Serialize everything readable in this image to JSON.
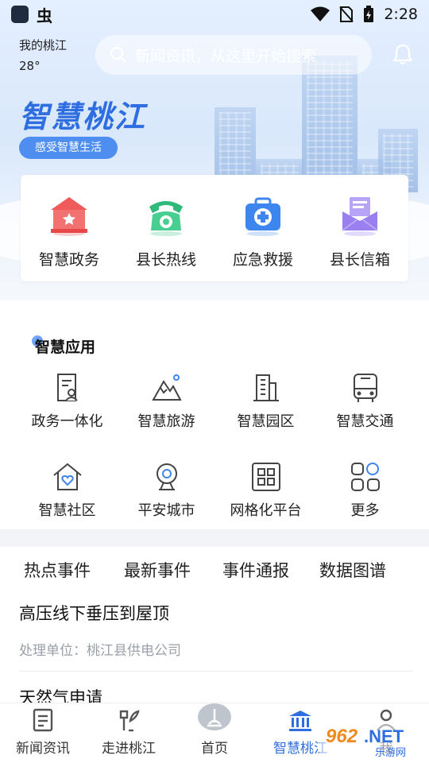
{
  "status_bar": {
    "time": "2:28",
    "app_glyph": "虫"
  },
  "header": {
    "location": "我的桃江",
    "temperature": "28°",
    "search_placeholder": "新闻资讯，从这里开始搜索",
    "brand": "智慧桃江",
    "slogan": "感受智慧生活"
  },
  "quick_entries": [
    {
      "label": "智慧政务",
      "icon": "government-building-icon",
      "color": "#ef5a5a"
    },
    {
      "label": "县长热线",
      "icon": "telephone-icon",
      "color": "#37c58a"
    },
    {
      "label": "应急救援",
      "icon": "first-aid-kit-icon",
      "color": "#3d86f0"
    },
    {
      "label": "县长信箱",
      "icon": "mailbox-icon",
      "color": "#9a7ff0"
    }
  ],
  "apps": {
    "title": "智慧应用",
    "items": [
      {
        "label": "政务一体化",
        "icon": "document-person-icon"
      },
      {
        "label": "智慧旅游",
        "icon": "mountain-icon"
      },
      {
        "label": "智慧园区",
        "icon": "office-building-icon"
      },
      {
        "label": "智慧交通",
        "icon": "bus-icon"
      },
      {
        "label": "智慧社区",
        "icon": "house-heart-icon"
      },
      {
        "label": "平安城市",
        "icon": "webcam-icon"
      },
      {
        "label": "网格化平台",
        "icon": "grid-icon"
      },
      {
        "label": "更多",
        "icon": "more-apps-icon"
      }
    ]
  },
  "news": {
    "tabs": [
      "热点事件",
      "最新事件",
      "事件通报",
      "数据图谱"
    ],
    "active_tab": "热点事件",
    "items": [
      {
        "title": "高压线下垂压到屋顶",
        "sub": "处理单位：桃江县供电公司"
      },
      {
        "title": "天然气申请",
        "sub": ""
      }
    ]
  },
  "bottom_nav": [
    {
      "label": "新闻资讯",
      "icon": "news-icon"
    },
    {
      "label": "走进桃江",
      "icon": "explore-icon"
    },
    {
      "label": "首页",
      "icon": "home-logo-icon"
    },
    {
      "label": "智慧桃江",
      "icon": "bank-icon",
      "active": true
    },
    {
      "label": "我",
      "icon": "user-icon"
    }
  ],
  "watermark": {
    "brand": "962.NET",
    "sub": "乐游网"
  },
  "colors": {
    "accent": "#2f6ee0"
  }
}
